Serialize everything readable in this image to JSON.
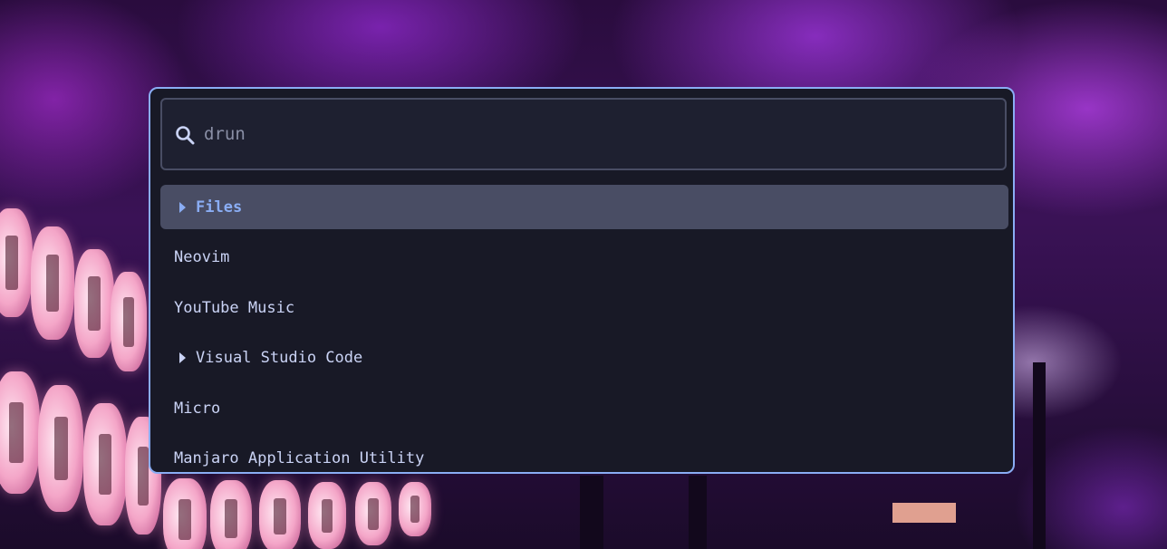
{
  "launcher": {
    "search": {
      "placeholder": "drun",
      "value": "",
      "icon": "search-icon"
    },
    "results": [
      {
        "label": "Files",
        "has_submenu": true,
        "selected": true
      },
      {
        "label": "Neovim",
        "has_submenu": false,
        "selected": false
      },
      {
        "label": "YouTube Music",
        "has_submenu": false,
        "selected": false
      },
      {
        "label": "Visual Studio Code",
        "has_submenu": true,
        "selected": false
      },
      {
        "label": "Micro",
        "has_submenu": false,
        "selected": false
      },
      {
        "label": "Manjaro Application Utility",
        "has_submenu": false,
        "selected": false
      }
    ]
  },
  "colors": {
    "border_accent": "#8aadf4",
    "background": "#181926",
    "selected_bg": "#494d64",
    "selected_text": "#8aadf4",
    "text": "#cad3f5"
  }
}
